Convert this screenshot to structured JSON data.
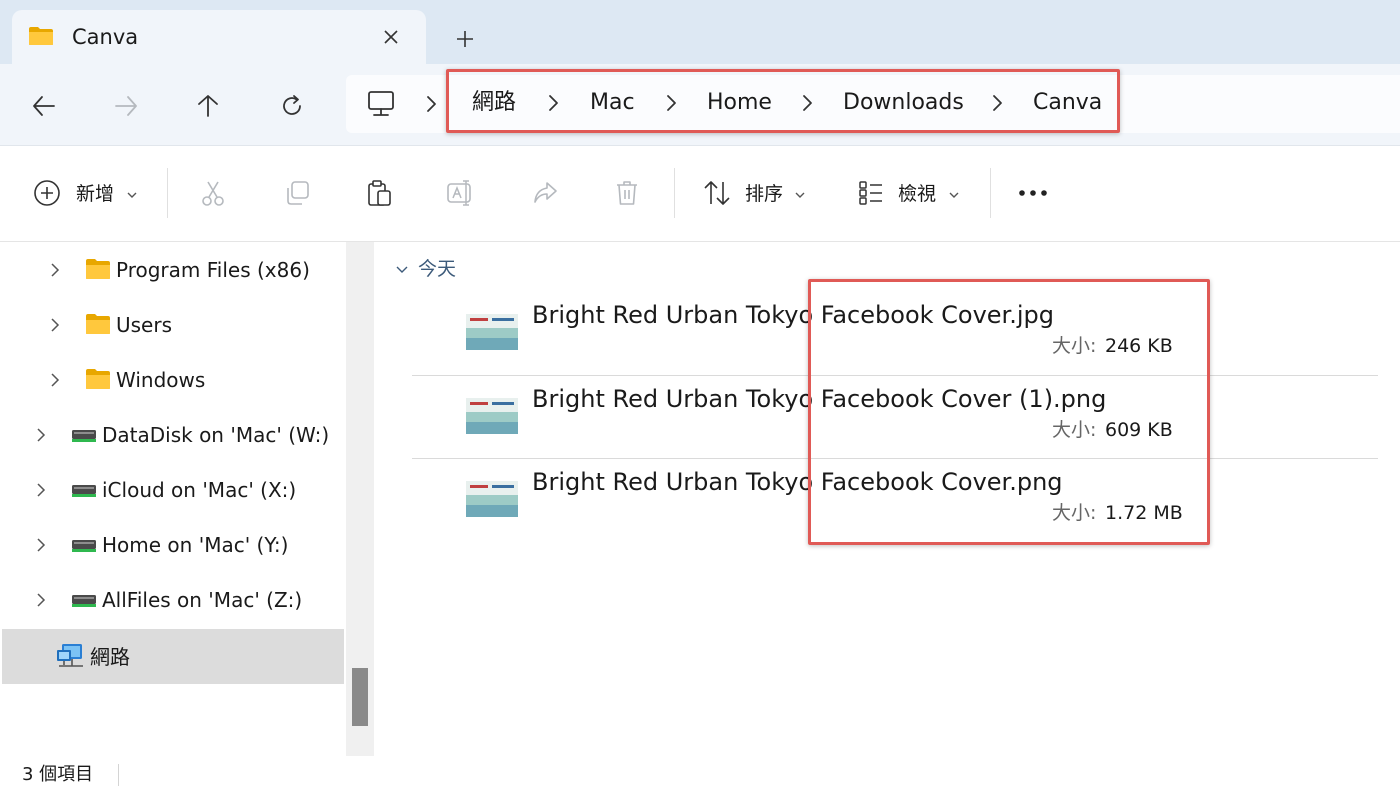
{
  "tab": {
    "title": "Canva",
    "close_icon": "close-icon",
    "new_tab_icon": "plus-icon"
  },
  "nav": {
    "back": "back-arrow-icon",
    "forward": "forward-arrow-icon",
    "up": "up-arrow-icon",
    "refresh": "refresh-icon"
  },
  "address": {
    "root_icon": "this-pc-icon",
    "crumbs": [
      "網路",
      "Mac",
      "Home",
      "Downloads",
      "Canva"
    ]
  },
  "toolbar": {
    "new_label": "新增",
    "sort_label": "排序",
    "view_label": "檢視",
    "more_icon": "more-icon"
  },
  "sidebar": {
    "items": [
      {
        "label": "Program Files (x86)",
        "icon": "folder-icon"
      },
      {
        "label": "Users",
        "icon": "folder-icon"
      },
      {
        "label": "Windows",
        "icon": "folder-icon"
      },
      {
        "label": "DataDisk on 'Mac' (W:)",
        "icon": "network-drive-icon"
      },
      {
        "label": "iCloud on 'Mac' (X:)",
        "icon": "network-drive-icon"
      },
      {
        "label": "Home on 'Mac' (Y:)",
        "icon": "network-drive-icon"
      },
      {
        "label": "AllFiles on 'Mac' (Z:)",
        "icon": "network-drive-icon"
      },
      {
        "label": "網路",
        "icon": "network-icon",
        "selected": true
      }
    ]
  },
  "content": {
    "group_label": "今天",
    "size_key": "大小:",
    "files": [
      {
        "name": "Bright Red Urban Tokyo Facebook Cover.jpg",
        "size": "246 KB"
      },
      {
        "name": "Bright Red Urban Tokyo Facebook Cover (1).png",
        "size": "609 KB"
      },
      {
        "name": "Bright Red Urban Tokyo Facebook Cover.png",
        "size": "1.72 MB"
      }
    ]
  },
  "status": {
    "item_count": "3 個項目"
  },
  "colors": {
    "highlight": "#e05a56",
    "tabstrip": "#dde8f3",
    "selected": "#dcdcdc"
  }
}
